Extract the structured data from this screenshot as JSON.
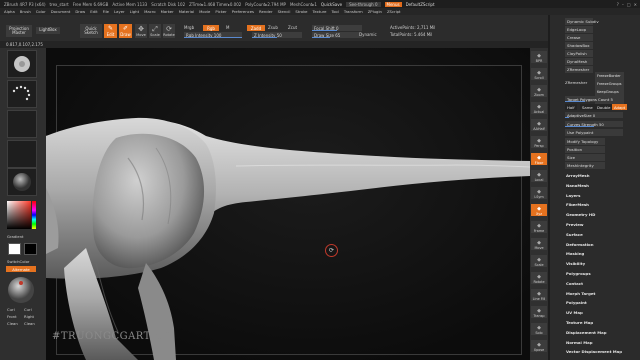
{
  "titlebar": {
    "app": "ZBrush 4R7 P3 (x64)",
    "document": "trex_start",
    "free_mem": "Free Mem 6.69GB",
    "active_mem": "Active Mem 1133",
    "scratch_disk": "Scratch Disk 102",
    "ztime": "ZTime▸1.468 Timer▸0.002",
    "poly_count": "PolyCount▸2.794 MP",
    "mesh_count": "MeshCount▸1",
    "quicksave": "QuickSave",
    "see_through": "See-through 0",
    "menus": "Menus",
    "default_script": "DefaultZScript"
  },
  "menu_items": [
    "Alpha",
    "Brush",
    "Color",
    "Document",
    "Draw",
    "Edit",
    "File",
    "Layer",
    "Light",
    "Macro",
    "Marker",
    "Material",
    "Movie",
    "Picker",
    "Preferences",
    "Render",
    "Stencil",
    "Stroke",
    "Texture",
    "Tool",
    "Transform",
    "ZPlugin",
    "ZScript"
  ],
  "toolbar": {
    "projection_master": "Projection Master",
    "lightbox": "LightBox",
    "quick_sketch": "Quick Sketch",
    "edit": "Edit",
    "draw": "Draw",
    "move": "Move",
    "scale": "Scale",
    "rotate": "Rotate",
    "mrgb": "Mrgb",
    "rgb": "Rgb",
    "m": "M",
    "rgb_intensity": "Rgb Intensity 100",
    "zadd": "Zadd",
    "zsub": "Zsub",
    "zcut": "Zcut",
    "z_intensity": "Z Intensity 50",
    "focal_shift": "Focal Shift 0",
    "draw_size": "Draw Size 65",
    "dynamic": "Dynamic",
    "active_points": "ActivePoints: 2,711 Mil",
    "total_points": "TotalPoints: 5.464 Mil"
  },
  "info_line": "0.817,0.107,2.175",
  "leftshelf": {
    "gradient": "Gradient",
    "switch_color": "SwitchColor",
    "alternate": "Alternate",
    "brush_labels": [
      "Curl",
      "Curl",
      "Front",
      "Right",
      "Clean",
      "Clean"
    ]
  },
  "viewport": {
    "watermark": "#TRUONGCGARTIST"
  },
  "right_shelf": [
    {
      "label": "BPR",
      "icon": "render-icon",
      "orange": false
    },
    {
      "label": "Scroll",
      "icon": "scroll-icon",
      "orange": false
    },
    {
      "label": "Zoom",
      "icon": "zoom-icon",
      "orange": false
    },
    {
      "label": "Actual",
      "icon": "actual-icon",
      "orange": false
    },
    {
      "label": "AAHalf",
      "icon": "aahalf-icon",
      "orange": false
    },
    {
      "label": "Persp",
      "icon": "persp-icon",
      "orange": false
    },
    {
      "label": "Floor",
      "icon": "floor-icon",
      "orange": true
    },
    {
      "label": "Local",
      "icon": "local-icon",
      "orange": false
    },
    {
      "label": "LSym",
      "icon": "lsym-icon",
      "orange": false
    },
    {
      "label": "Xyz",
      "icon": "xyz-icon",
      "orange": true
    },
    {
      "label": "Frame",
      "icon": "frame-icon",
      "orange": false
    },
    {
      "label": "Move",
      "icon": "move-icon",
      "orange": false
    },
    {
      "label": "Scale",
      "icon": "scale-icon",
      "orange": false
    },
    {
      "label": "Rotate",
      "icon": "rotate-icon",
      "orange": false
    },
    {
      "label": "Line Fill",
      "icon": "linefill-icon",
      "orange": false
    },
    {
      "label": "Transp",
      "icon": "transp-icon",
      "orange": false
    },
    {
      "label": "Solo",
      "icon": "solo-icon",
      "orange": false
    },
    {
      "label": "Xpose",
      "icon": "xpose-icon",
      "orange": false
    }
  ],
  "palette": {
    "top_buttons": [
      "Dynamic Subdiv",
      "EdgeLoop",
      "Crease",
      "ShadowBox",
      "ClayPolish",
      "DynaMesh",
      "ZRemesher"
    ],
    "frozen_items": [
      "FreezeBorder",
      "FreezeGroups",
      "KeepGroups"
    ],
    "zremesher_sub": "ZRemesher",
    "target_poly": "Target Polygons Count 5",
    "half": "Half",
    "same": "Same",
    "double": "Double",
    "adapt": "Adapt",
    "adaptive_size": "AdaptiveSize 0",
    "curves_strength": "Curves Strength 50",
    "use_polypaint": "Use Polypaint",
    "sections": [
      "Modify Topology",
      "Position",
      "Size",
      "MeshIntegrity",
      "ArrayMesh",
      "NanoMesh",
      "Layers",
      "FiberMesh",
      "Geometry HD",
      "Preview",
      "Surface",
      "Deformation",
      "Masking",
      "Visibility",
      "Polygroups",
      "Contact",
      "Morph Target",
      "Polypaint",
      "UV Map",
      "Texture Map",
      "Displacement Map",
      "Normal Map",
      "Vector Displacement Map"
    ]
  },
  "colors": {
    "accent": "#e5721f",
    "slider_fill": "#5a8ad0"
  }
}
